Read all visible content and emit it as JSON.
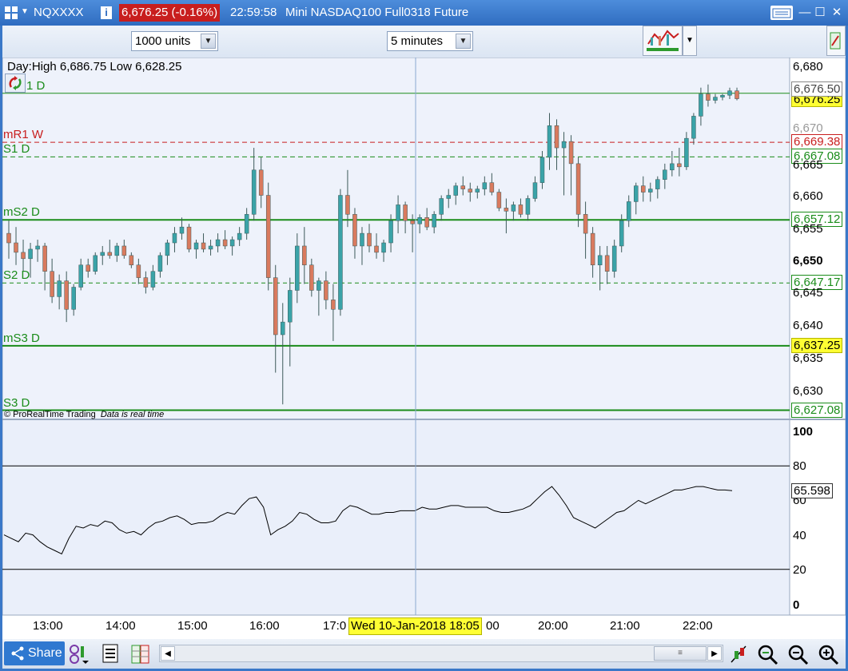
{
  "titlebar": {
    "symbol": "NQXXXX",
    "info_icon": "info-icon",
    "price_change": "6,676.25 (-0.16%)",
    "time": "22:59:58",
    "description": "Mini NASDAQ100 Full0318 Future"
  },
  "toolbar": {
    "units_value": "1000 units",
    "interval_value": "5 minutes"
  },
  "chart": {
    "day_info": "Day:High 6,686.75 Low 6,628.25",
    "copyright": "© ProRealTime Trading",
    "realtime_note": "Data is real time",
    "crosshair_date": "Wed 10-Jan-2018 18:05",
    "x_labels": [
      "13:00",
      "14:00",
      "15:00",
      "16:00",
      "17:0",
      "00",
      "20:00",
      "21:00",
      "22:00"
    ],
    "price_axis": [
      "6,680",
      "6,676.50",
      "6,665",
      "6,660",
      "6,655",
      "6,650",
      "6,645",
      "6,640",
      "6,635",
      "6,630",
      "6,670"
    ],
    "levels": [
      {
        "label": "1 D",
        "value": "6,677.12",
        "price": 6677.12,
        "style": "solid",
        "color": "green"
      },
      {
        "label": "mR1 W",
        "value": "6,669.38",
        "price": 6669.38,
        "style": "dashed",
        "color": "red"
      },
      {
        "label": "S1 D",
        "value": "6,667.08",
        "price": 6667.08,
        "style": "dashed",
        "color": "green"
      },
      {
        "label": "mS2 D",
        "value": "6,657.12",
        "price": 6657.12,
        "style": "solid",
        "color": "green"
      },
      {
        "label": "S2 D",
        "value": "6,647.17",
        "price": 6647.17,
        "style": "dashed",
        "color": "green"
      },
      {
        "label": "mS3 D",
        "value": "6,637.25",
        "price": 6637.25,
        "style": "solid",
        "color": "green"
      },
      {
        "label": "S3 D",
        "value": "6,627.08",
        "price": 6627.08,
        "style": "solid",
        "color": "green"
      }
    ],
    "current_price": "6,676.25",
    "current_price_value": 6676.25,
    "rsi_axis": [
      "100",
      "80",
      "60",
      "40",
      "20",
      "0"
    ],
    "rsi_value": "65.598",
    "colors": {
      "up": "#3aa3a8",
      "down": "#d97a5e",
      "level_green": "#1a8c1a",
      "level_red": "#c81e1e",
      "highlight": "#ffff33"
    }
  },
  "chart_data": {
    "type": "candlestick",
    "ylim": [
      6625,
      6682
    ],
    "candles": [
      [
        6655.0,
        6657.0,
        6651.0,
        6653.5
      ],
      [
        6653.5,
        6656.0,
        6650.0,
        6652.0
      ],
      [
        6652.0,
        6654.0,
        6649.0,
        6651.0
      ],
      [
        6651.0,
        6653.5,
        6648.0,
        6652.5
      ],
      [
        6652.5,
        6654.0,
        6650.5,
        6653.0
      ],
      [
        6653.0,
        6653.5,
        6646.0,
        6649.0
      ],
      [
        6649.0,
        6651.0,
        6644.0,
        6645.0
      ],
      [
        6645.0,
        6648.5,
        6643.0,
        6647.5
      ],
      [
        6647.5,
        6649.0,
        6641.0,
        6643.0
      ],
      [
        6643.0,
        6647.0,
        6642.0,
        6646.5
      ],
      [
        6646.5,
        6651.0,
        6646.0,
        6650.0
      ],
      [
        6650.0,
        6651.0,
        6648.0,
        6649.0
      ],
      [
        6649.0,
        6652.0,
        6648.5,
        6651.5
      ],
      [
        6651.5,
        6653.0,
        6650.0,
        6652.0
      ],
      [
        6652.0,
        6654.0,
        6651.0,
        6651.5
      ],
      [
        6651.5,
        6653.5,
        6650.5,
        6653.0
      ],
      [
        6653.0,
        6654.0,
        6651.0,
        6651.5
      ],
      [
        6651.5,
        6652.0,
        6649.5,
        6650.0
      ],
      [
        6650.0,
        6651.0,
        6647.0,
        6648.0
      ],
      [
        6648.0,
        6649.0,
        6645.5,
        6646.5
      ],
      [
        6646.5,
        6650.0,
        6646.0,
        6649.0
      ],
      [
        6649.0,
        6652.0,
        6648.0,
        6651.5
      ],
      [
        6651.5,
        6654.0,
        6650.0,
        6653.5
      ],
      [
        6653.5,
        6656.0,
        6652.0,
        6655.0
      ],
      [
        6655.0,
        6657.5,
        6654.0,
        6656.0
      ],
      [
        6656.0,
        6656.5,
        6652.0,
        6652.5
      ],
      [
        6652.5,
        6654.0,
        6651.0,
        6653.5
      ],
      [
        6653.5,
        6655.0,
        6652.0,
        6652.5
      ],
      [
        6652.5,
        6654.0,
        6651.5,
        6653.0
      ],
      [
        6653.0,
        6655.0,
        6652.0,
        6654.0
      ],
      [
        6654.0,
        6655.5,
        6652.5,
        6653.0
      ],
      [
        6653.0,
        6654.5,
        6651.5,
        6654.0
      ],
      [
        6654.0,
        6656.0,
        6653.0,
        6655.0
      ],
      [
        6655.0,
        6659.0,
        6654.0,
        6658.0
      ],
      [
        6658.0,
        6668.5,
        6657.0,
        6665.0
      ],
      [
        6665.0,
        6667.0,
        6659.0,
        6661.0
      ],
      [
        6661.0,
        6663.0,
        6646.0,
        6648.0
      ],
      [
        6648.0,
        6650.0,
        6633.0,
        6639.0
      ],
      [
        6639.0,
        6644.0,
        6628.0,
        6641.0
      ],
      [
        6641.0,
        6648.0,
        6634.0,
        6646.0
      ],
      [
        6646.0,
        6655.0,
        6644.0,
        6653.0
      ],
      [
        6653.0,
        6656.0,
        6647.0,
        6650.0
      ],
      [
        6650.0,
        6651.0,
        6645.0,
        6646.0
      ],
      [
        6646.0,
        6648.0,
        6642.0,
        6647.5
      ],
      [
        6647.5,
        6649.0,
        6643.0,
        6644.5
      ],
      [
        6644.5,
        6647.0,
        6638.0,
        6643.0
      ],
      [
        6643.0,
        6662.0,
        6642.0,
        6661.0
      ],
      [
        6661.0,
        6665.0,
        6656.0,
        6658.0
      ],
      [
        6658.0,
        6659.0,
        6651.0,
        6653.0
      ],
      [
        6653.0,
        6656.0,
        6650.0,
        6655.0
      ],
      [
        6655.0,
        6656.5,
        6652.0,
        6653.0
      ],
      [
        6653.0,
        6655.0,
        6651.0,
        6652.0
      ],
      [
        6652.0,
        6654.0,
        6650.5,
        6653.5
      ],
      [
        6653.5,
        6658.0,
        6652.0,
        6657.0
      ],
      [
        6657.0,
        6661.0,
        6655.0,
        6659.5
      ],
      [
        6659.5,
        6660.0,
        6655.0,
        6657.0
      ],
      [
        6657.0,
        6658.0,
        6652.0,
        6656.5
      ],
      [
        6656.5,
        6658.0,
        6655.0,
        6657.5
      ],
      [
        6657.5,
        6659.0,
        6655.5,
        6656.0
      ],
      [
        6656.0,
        6658.5,
        6655.0,
        6658.0
      ],
      [
        6658.0,
        6661.0,
        6657.0,
        6660.5
      ],
      [
        6660.5,
        6662.0,
        6659.0,
        6661.0
      ],
      [
        6661.0,
        6663.0,
        6659.5,
        6662.5
      ],
      [
        6662.5,
        6664.0,
        6661.0,
        6662.0
      ],
      [
        6662.0,
        6663.0,
        6660.0,
        6661.5
      ],
      [
        6661.5,
        6662.5,
        6660.5,
        6662.0
      ],
      [
        6662.0,
        6664.0,
        6661.0,
        6663.0
      ],
      [
        6663.0,
        6664.5,
        6661.0,
        6661.5
      ],
      [
        6661.5,
        6662.0,
        6658.5,
        6659.0
      ],
      [
        6659.0,
        6660.5,
        6655.0,
        6658.5
      ],
      [
        6658.5,
        6660.0,
        6657.0,
        6659.5
      ],
      [
        6659.5,
        6660.5,
        6657.5,
        6658.0
      ],
      [
        6658.0,
        6661.0,
        6657.0,
        6660.5
      ],
      [
        6660.5,
        6664.0,
        6660.0,
        6663.0
      ],
      [
        6663.0,
        6668.0,
        6662.0,
        6667.0
      ],
      [
        6667.0,
        6674.0,
        6665.0,
        6672.0
      ],
      [
        6672.0,
        6673.0,
        6665.0,
        6668.5
      ],
      [
        6668.5,
        6671.0,
        6661.0,
        6669.5
      ],
      [
        6669.5,
        6670.5,
        6661.0,
        6666.0
      ],
      [
        6666.0,
        6667.0,
        6656.0,
        6658.0
      ],
      [
        6658.0,
        6660.0,
        6651.0,
        6655.0
      ],
      [
        6655.0,
        6656.0,
        6648.0,
        6650.0
      ],
      [
        6650.0,
        6653.0,
        6646.0,
        6651.5
      ],
      [
        6651.5,
        6653.0,
        6647.0,
        6649.0
      ],
      [
        6649.0,
        6654.0,
        6648.0,
        6653.0
      ],
      [
        6653.0,
        6658.0,
        6652.0,
        6657.0
      ],
      [
        6657.0,
        6661.0,
        6656.0,
        6660.0
      ],
      [
        6660.0,
        6663.0,
        6658.0,
        6662.5
      ],
      [
        6662.5,
        6664.0,
        6660.0,
        6661.5
      ],
      [
        6661.5,
        6663.0,
        6660.0,
        6662.0
      ],
      [
        6662.0,
        6664.0,
        6660.5,
        6663.5
      ],
      [
        6663.5,
        6666.0,
        6662.0,
        6665.0
      ],
      [
        6665.0,
        6668.0,
        6664.0,
        6666.0
      ],
      [
        6666.0,
        6668.5,
        6664.0,
        6665.5
      ],
      [
        6665.5,
        6671.0,
        6665.0,
        6670.0
      ],
      [
        6670.0,
        6674.0,
        6669.0,
        6673.5
      ],
      [
        6673.5,
        6678.0,
        6672.0,
        6677.0
      ],
      [
        6677.0,
        6678.5,
        6675.0,
        6676.0
      ],
      [
        6676.0,
        6677.0,
        6675.5,
        6676.5
      ],
      [
        6676.5,
        6677.0,
        6676.0,
        6676.8
      ],
      [
        6676.8,
        6678.0,
        6676.2,
        6677.5
      ],
      [
        6677.5,
        6678.0,
        6676.0,
        6676.25
      ]
    ],
    "rsi": [
      40,
      38,
      36,
      41,
      40,
      36,
      33,
      31,
      29,
      38,
      45,
      44,
      46,
      45,
      48,
      47,
      43,
      41,
      42,
      40,
      44,
      47,
      48,
      50,
      51,
      49,
      46,
      47,
      47,
      48,
      51,
      53,
      52,
      57,
      61,
      62,
      56,
      40,
      43,
      45,
      48,
      53,
      52,
      49,
      47,
      47,
      48,
      54,
      57,
      56,
      54,
      52,
      52,
      53,
      53,
      54,
      54,
      54,
      56,
      55,
      55,
      56,
      57,
      57,
      56,
      56,
      56,
      56,
      54,
      53,
      53,
      54,
      55,
      57,
      61,
      65,
      68,
      63,
      57,
      50,
      48,
      46,
      44,
      47,
      50,
      53,
      54,
      57,
      60,
      58,
      60,
      62,
      64,
      66,
      66,
      67,
      68,
      68,
      67,
      66,
      66,
      65.6
    ]
  },
  "bottombar": {
    "share_label": "Share"
  }
}
